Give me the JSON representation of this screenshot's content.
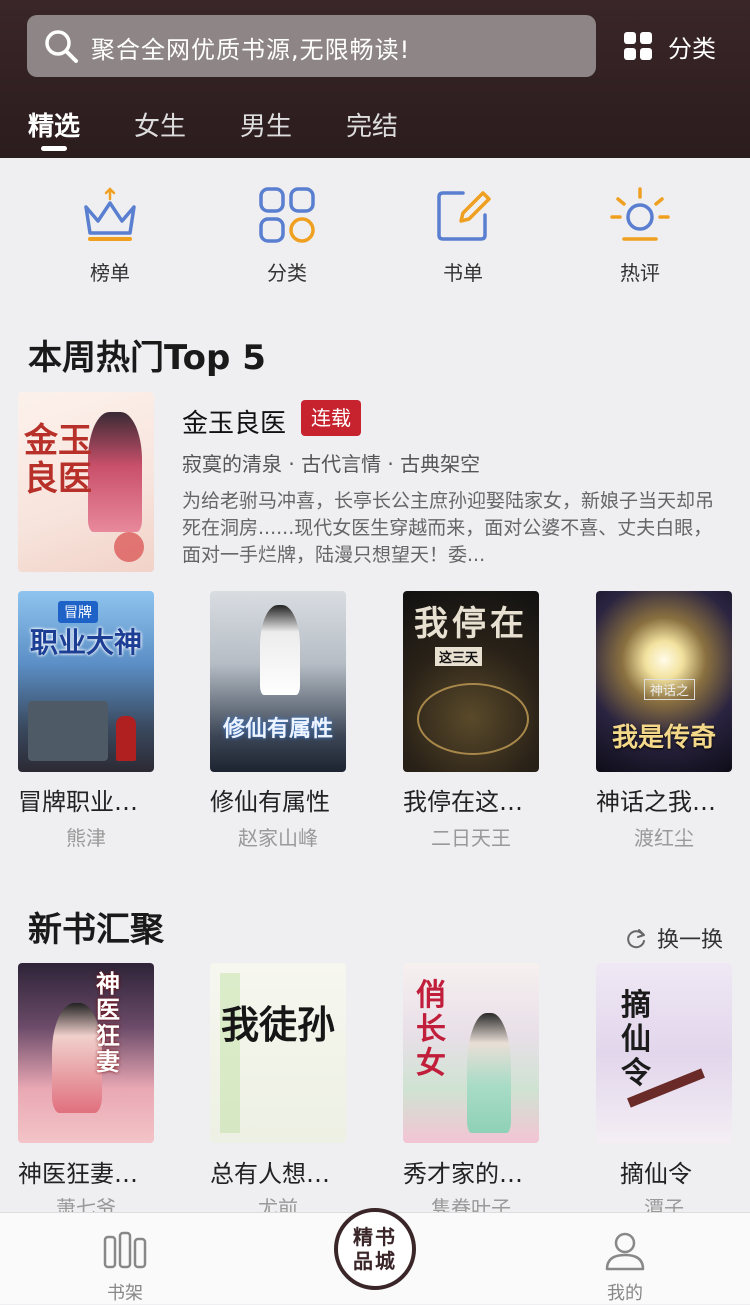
{
  "search": {
    "placeholder": "聚合全网优质书源,无限畅读!"
  },
  "category_button": "分类",
  "tabs": [
    "精选",
    "女生",
    "男生",
    "完结"
  ],
  "quick_links": [
    "榜单",
    "分类",
    "书单",
    "热评"
  ],
  "hot_section": {
    "title": "本周热门Top 5",
    "featured": {
      "title": "金玉良医",
      "badge": "连载",
      "meta": "寂寞的清泉 · 古代言情 · 古典架空",
      "description": "为给老驸马冲喜，长亭长公主庶孙迎娶陆家女，新娘子当天却吊死在洞房......现代女医生穿越而来，面对公婆不喜、丈夫白眼，面对一手烂牌，陆漫只想望天！委...",
      "cover_text": "金玉良医"
    },
    "books": [
      {
        "title": "冒牌职业…",
        "author": "熊津",
        "cover_text": "职业大神",
        "cover_tag": "冒牌"
      },
      {
        "title": "修仙有属性",
        "author": "赵家山峰",
        "cover_text": "修仙有属性",
        "cover_tag": ""
      },
      {
        "title": "我停在这…",
        "author": "二日天王",
        "cover_text": "我停在",
        "cover_tag": "这三天"
      },
      {
        "title": "神话之我…",
        "author": "渡红尘",
        "cover_text": "我是传奇",
        "cover_tag": "神话之"
      }
    ]
  },
  "new_section": {
    "title": "新书汇聚",
    "refresh_label": "换一换",
    "books": [
      {
        "title": "神医狂妻…",
        "author": "萧七爷",
        "cover_text": "神医狂妻"
      },
      {
        "title": "总有人想…",
        "author": "尤前",
        "cover_text": "我徒孙"
      },
      {
        "title": "秀才家的…",
        "author": "隽眷叶子",
        "cover_text": "俏长女"
      },
      {
        "title": "摘仙令",
        "author": "潭子",
        "cover_text": "摘仙令"
      }
    ]
  },
  "tabbar": {
    "left": "书架",
    "center": "精书品城",
    "right": "我的"
  }
}
